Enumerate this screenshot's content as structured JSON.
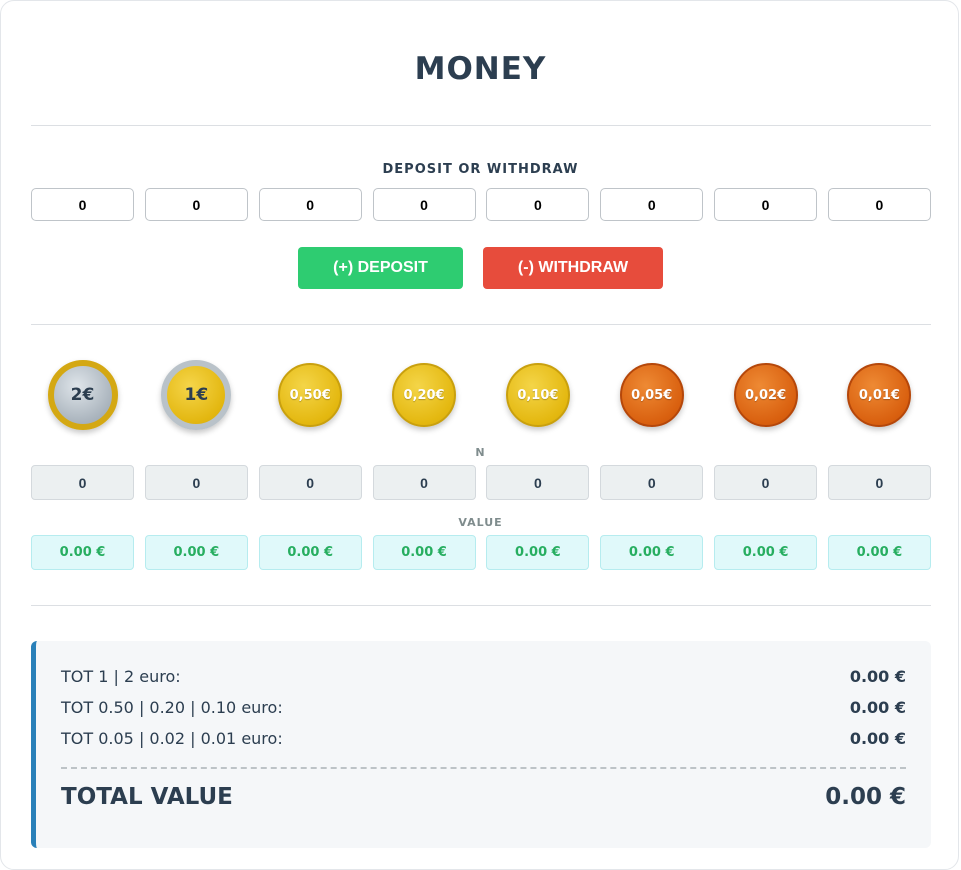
{
  "title": "MONEY",
  "deposit_section": {
    "label": "DEPOSIT OR WITHDRAW",
    "inputs": [
      "0",
      "0",
      "0",
      "0",
      "0",
      "0",
      "0",
      "0"
    ],
    "deposit_button": "(+) DEPOSIT",
    "withdraw_button": "(-) WITHDRAW"
  },
  "coins": [
    {
      "label": "2€"
    },
    {
      "label": "1€"
    },
    {
      "label": "0,50€"
    },
    {
      "label": "0,20€"
    },
    {
      "label": "0,10€"
    },
    {
      "label": "0,05€"
    },
    {
      "label": "0,02€"
    },
    {
      "label": "0,01€"
    }
  ],
  "counts_label": "N",
  "counts": [
    "0",
    "0",
    "0",
    "0",
    "0",
    "0",
    "0",
    "0"
  ],
  "values_label": "VALUE",
  "values": [
    "0.00 €",
    "0.00 €",
    "0.00 €",
    "0.00 €",
    "0.00 €",
    "0.00 €",
    "0.00 €",
    "0.00 €"
  ],
  "summary": {
    "rows": [
      {
        "label": "TOT 1 | 2 euro:",
        "amount": "0.00 €"
      },
      {
        "label": "TOT 0.50 | 0.20 | 0.10 euro:",
        "amount": "0.00 €"
      },
      {
        "label": "TOT 0.05 | 0.02 | 0.01 euro:",
        "amount": "0.00 €"
      }
    ],
    "total_label": "TOTAL VALUE",
    "total_amount": "0.00 €"
  },
  "colors": {
    "deposit": "#2ecc71",
    "withdraw": "#e74c3c",
    "accent": "#2980b9",
    "value_text": "#27ae60"
  }
}
